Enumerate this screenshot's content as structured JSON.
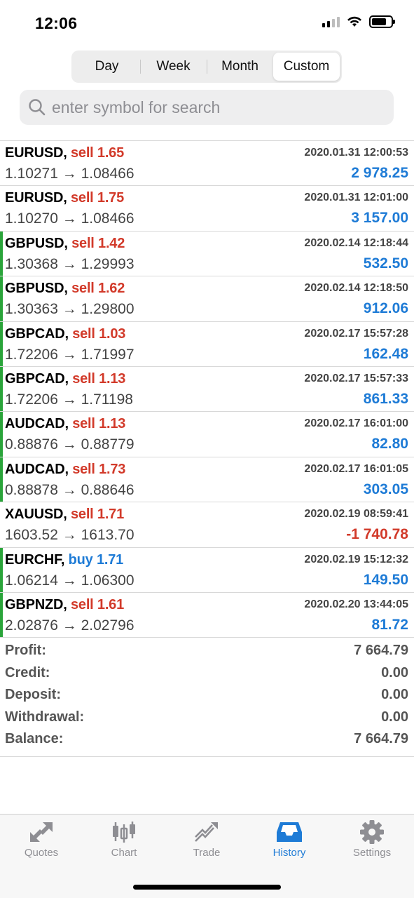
{
  "status": {
    "time": "12:06"
  },
  "period_tabs": [
    {
      "label": "Day",
      "active": false
    },
    {
      "label": "Week",
      "active": false
    },
    {
      "label": "Month",
      "active": false
    },
    {
      "label": "Custom",
      "active": true
    }
  ],
  "search": {
    "placeholder": "enter symbol for search",
    "icon": "search-icon"
  },
  "deals": [
    {
      "symbol": "EURUSD,",
      "side": "sell",
      "volume": "1.65",
      "datetime": "2020.01.31 12:00:53",
      "open": "1.10271",
      "close": "1.08466",
      "profit": "2 978.25",
      "bar": false
    },
    {
      "symbol": "EURUSD,",
      "side": "sell",
      "volume": "1.75",
      "datetime": "2020.01.31 12:01:00",
      "open": "1.10270",
      "close": "1.08466",
      "profit": "3 157.00",
      "bar": false
    },
    {
      "symbol": "GBPUSD,",
      "side": "sell",
      "volume": "1.42",
      "datetime": "2020.02.14 12:18:44",
      "open": "1.30368",
      "close": "1.29993",
      "profit": "532.50",
      "bar": true
    },
    {
      "symbol": "GBPUSD,",
      "side": "sell",
      "volume": "1.62",
      "datetime": "2020.02.14 12:18:50",
      "open": "1.30363",
      "close": "1.29800",
      "profit": "912.06",
      "bar": true
    },
    {
      "symbol": "GBPCAD,",
      "side": "sell",
      "volume": "1.03",
      "datetime": "2020.02.17 15:57:28",
      "open": "1.72206",
      "close": "1.71997",
      "profit": "162.48",
      "bar": true
    },
    {
      "symbol": "GBPCAD,",
      "side": "sell",
      "volume": "1.13",
      "datetime": "2020.02.17 15:57:33",
      "open": "1.72206",
      "close": "1.71198",
      "profit": "861.33",
      "bar": true
    },
    {
      "symbol": "AUDCAD,",
      "side": "sell",
      "volume": "1.13",
      "datetime": "2020.02.17 16:01:00",
      "open": "0.88876",
      "close": "0.88779",
      "profit": "82.80",
      "bar": true
    },
    {
      "symbol": "AUDCAD,",
      "side": "sell",
      "volume": "1.73",
      "datetime": "2020.02.17 16:01:05",
      "open": "0.88878",
      "close": "0.88646",
      "profit": "303.05",
      "bar": true
    },
    {
      "symbol": "XAUUSD,",
      "side": "sell",
      "volume": "1.71",
      "datetime": "2020.02.19 08:59:41",
      "open": "1603.52",
      "close": "1613.70",
      "profit": "-1 740.78",
      "bar": false
    },
    {
      "symbol": "EURCHF,",
      "side": "buy",
      "volume": "1.71",
      "datetime": "2020.02.19 15:12:32",
      "open": "1.06214",
      "close": "1.06300",
      "profit": "149.50",
      "bar": true
    },
    {
      "symbol": "GBPNZD,",
      "side": "sell",
      "volume": "1.61",
      "datetime": "2020.02.20 13:44:05",
      "open": "2.02876",
      "close": "2.02796",
      "profit": "81.72",
      "bar": true
    }
  ],
  "arrow": "→",
  "summary": [
    {
      "label": "Profit:",
      "value": "7 664.79"
    },
    {
      "label": "Credit:",
      "value": "0.00"
    },
    {
      "label": "Deposit:",
      "value": "0.00"
    },
    {
      "label": "Withdrawal:",
      "value": "0.00"
    },
    {
      "label": "Balance:",
      "value": "7 664.79"
    }
  ],
  "tabs": [
    {
      "label": "Quotes",
      "icon": "quotes-icon",
      "active": false
    },
    {
      "label": "Chart",
      "icon": "chart-icon",
      "active": false
    },
    {
      "label": "Trade",
      "icon": "trade-icon",
      "active": false
    },
    {
      "label": "History",
      "icon": "history-icon",
      "active": true
    },
    {
      "label": "Settings",
      "icon": "gear-icon",
      "active": false
    }
  ],
  "colors": {
    "sell": "#d23a2a",
    "buy": "#1e7bd6",
    "profit_positive": "#1e7bd6",
    "profit_negative": "#d23a2a",
    "accent": "#1e7bd6",
    "bar": "#2aa43a"
  }
}
